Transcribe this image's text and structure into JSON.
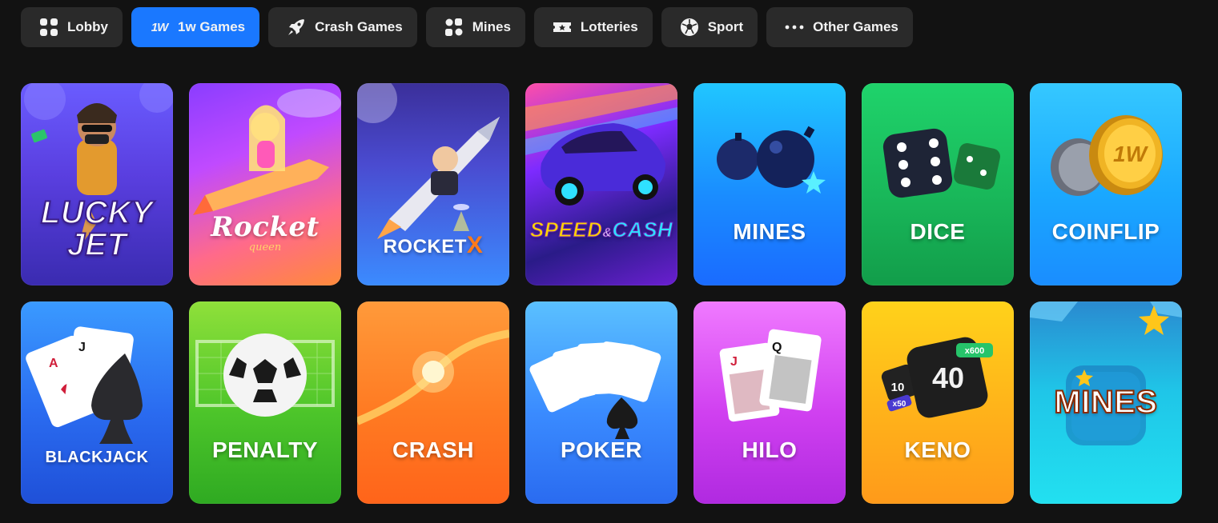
{
  "tabs": [
    {
      "label": "Lobby",
      "icon": "grid-icon",
      "active": false
    },
    {
      "label": "1w Games",
      "icon": "1w-logo-icon",
      "icon_text": "1W",
      "active": true
    },
    {
      "label": "Crash Games",
      "icon": "rocket-icon",
      "active": false
    },
    {
      "label": "Mines",
      "icon": "mines-grid-icon",
      "active": false
    },
    {
      "label": "Lotteries",
      "icon": "ticket-icon",
      "active": false
    },
    {
      "label": "Sport",
      "icon": "soccer-ball-icon",
      "active": false
    },
    {
      "label": "Other Games",
      "icon": "more-dots-icon",
      "active": false
    }
  ],
  "games": [
    {
      "title_line1": "LUCKY",
      "title_line2": "JET"
    },
    {
      "title": "Rocket",
      "subtitle": "queen"
    },
    {
      "title_main": "ROCKET",
      "title_accent": "X"
    },
    {
      "title_a": "SPEED",
      "title_amp": "&",
      "title_b": "CASH"
    },
    {
      "title": "MINES"
    },
    {
      "title": "DICE"
    },
    {
      "title": "COINFLIP",
      "coin_text": "1W"
    },
    {
      "title": "BLACKJACK"
    },
    {
      "title": "PENALTY"
    },
    {
      "title": "CRASH"
    },
    {
      "title": "POKER"
    },
    {
      "title": "HILO"
    },
    {
      "title": "KENO",
      "badge_top": "x600",
      "die_value": "40",
      "die_small": "10",
      "badge_small": "x50"
    },
    {
      "title": "MINES"
    }
  ],
  "colors": {
    "background": "#121212",
    "tab_bg": "#2a2a2a",
    "tab_active": "#1a78ff"
  }
}
